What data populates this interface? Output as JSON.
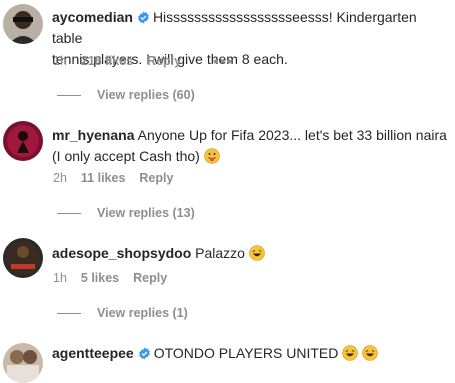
{
  "comments": [
    {
      "username": "aycomedian",
      "verified": true,
      "text_line1": "Hisssssssssssssssssseesss! Kindergarten table",
      "text_line2": "tennis players. I will give them 8 each.",
      "time": "1h",
      "likes": "218 likes",
      "reply": "Reply",
      "more": "•••",
      "view_replies": "View replies (60)"
    },
    {
      "username": "mr_hyenana",
      "verified": false,
      "text_line1": "Anyone Up for Fifa 2023... let's bet 33 billion naira",
      "text_line2": "(I only accept Cash tho)",
      "time": "2h",
      "likes": "11 likes",
      "reply": "Reply",
      "view_replies": "View replies (13)"
    },
    {
      "username": "adesope_shopsydoo",
      "verified": false,
      "text_line1": "Palazzo",
      "time": "1h",
      "likes": "5 likes",
      "reply": "Reply",
      "view_replies": "View replies (1)"
    },
    {
      "username": "agentteepee",
      "verified": true,
      "text_line1": "OTONDO PLAYERS UNITED"
    }
  ],
  "colors": {
    "verified_badge": "#3897f0",
    "meta_gray": "#8e8e8e",
    "text": "#262626"
  }
}
